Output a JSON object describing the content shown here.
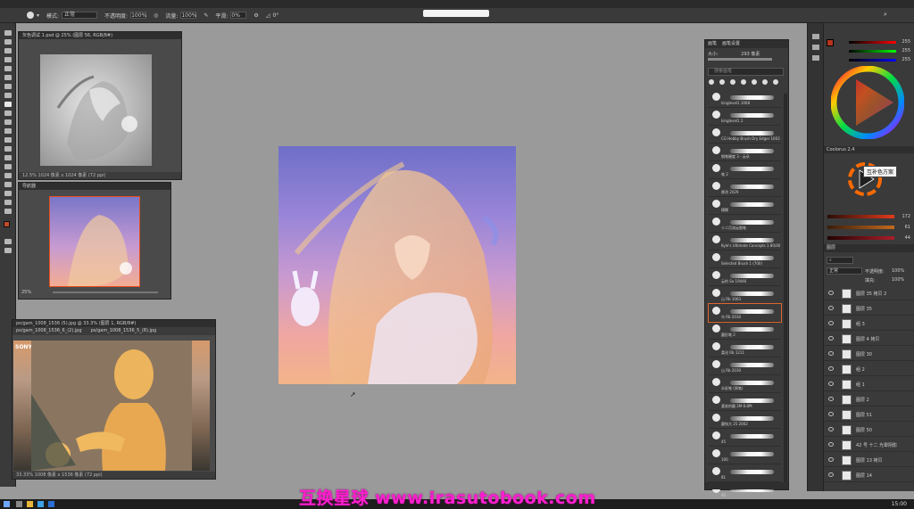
{
  "app": {
    "watermark": "互换星球 www.irasutobook.com",
    "tooltip": "互补色方案"
  },
  "options_bar": {
    "mode_label": "模式:",
    "mode_value": "正常",
    "opacity_label": "不透明度:",
    "opacity_value": "100%",
    "flow_label": "流量:",
    "flow_value": "100%",
    "smooth_label": "平滑:",
    "smooth_value": "0%",
    "angle_value": "0°"
  },
  "windows": {
    "grayscale_title": "灰色调试 1.psd @ 25% (图层 56, RGB/8#)",
    "grayscale_status": "12.5%  1024 像素 x 1024 像素 (72 ppi)",
    "navigator_title": "导航器",
    "navigator_zoom": "25%",
    "reference_title": "ps/gam_1008_1536 (5).jpg @ 33.3% (图层 1, RGB/8#)",
    "reference_tab1": "ps/gam_1008_1536_6_(2).jpg",
    "reference_tab2": "ps/gam_1008_1536_5_(8).jpg",
    "reference_status": "33.33%  1008 像素 x 1536 像素 (72 ppi)",
    "reference_brand": "SONY"
  },
  "brush_panel": {
    "tab1": "画笔",
    "tab2": "画笔设置",
    "size_label": "大小:",
    "size_value": "293 像素",
    "search_placeholder": "搜索画笔",
    "brushes": [
      {
        "label": "kinglevel1 1008"
      },
      {
        "label": "kinglevel1 2"
      },
      {
        "label": "CG Hobby Brush Dry Edger 1003"
      },
      {
        "label": "钢笔硬度 3 - 云朵"
      },
      {
        "label": "笔 2"
      },
      {
        "label": "厚涂 2029"
      },
      {
        "label": "模糊"
      },
      {
        "label": "十二月流云细笔"
      },
      {
        "label": "Kyle's Ultimate Concepts 1 80/40"
      },
      {
        "label": "Selected Brush 1 (700)"
      },
      {
        "label": "云的 Sa 19446"
      },
      {
        "label": "山 Rb 1063"
      },
      {
        "label": "鸟 Rb 2030"
      },
      {
        "label": "圆形笔 2"
      },
      {
        "label": "柔化 Rb 1211"
      },
      {
        "label": "山 Rb 2030"
      },
      {
        "label": "水彩笔 (原笔)"
      },
      {
        "label": "柔软的圆 2M 8.8Pt"
      },
      {
        "label": "圆钝大 25 2002"
      },
      {
        "label": "45"
      },
      {
        "label": "100"
      },
      {
        "label": "81"
      },
      {
        "label": "40"
      }
    ]
  },
  "right_panel": {
    "channel_r": "255",
    "channel_g": "255",
    "channel_b": "255",
    "color_values": [
      "172",
      "61",
      "44"
    ],
    "harmony_label": "Coolorus 2.4",
    "layers_tab": "图层",
    "blend_mode": "正常",
    "opacity_label": "不透明度:",
    "opacity_value": "100%",
    "fill_label": "填充:",
    "fill_value": "100%",
    "layers": [
      {
        "name": "图层 35 拷贝 2"
      },
      {
        "name": "图层 35"
      },
      {
        "name": "组 3"
      },
      {
        "name": "图层 4 拷贝"
      },
      {
        "name": "图层 30"
      },
      {
        "name": "组 2"
      },
      {
        "name": "组 1"
      },
      {
        "name": "图层 2"
      },
      {
        "name": "图层 51"
      },
      {
        "name": "图层 50"
      },
      {
        "name": "42 号 十二 光晕阴影"
      },
      {
        "name": "图层 13 拷贝"
      },
      {
        "name": "图层 14"
      }
    ]
  },
  "taskbar": {
    "clock": "15:00"
  }
}
